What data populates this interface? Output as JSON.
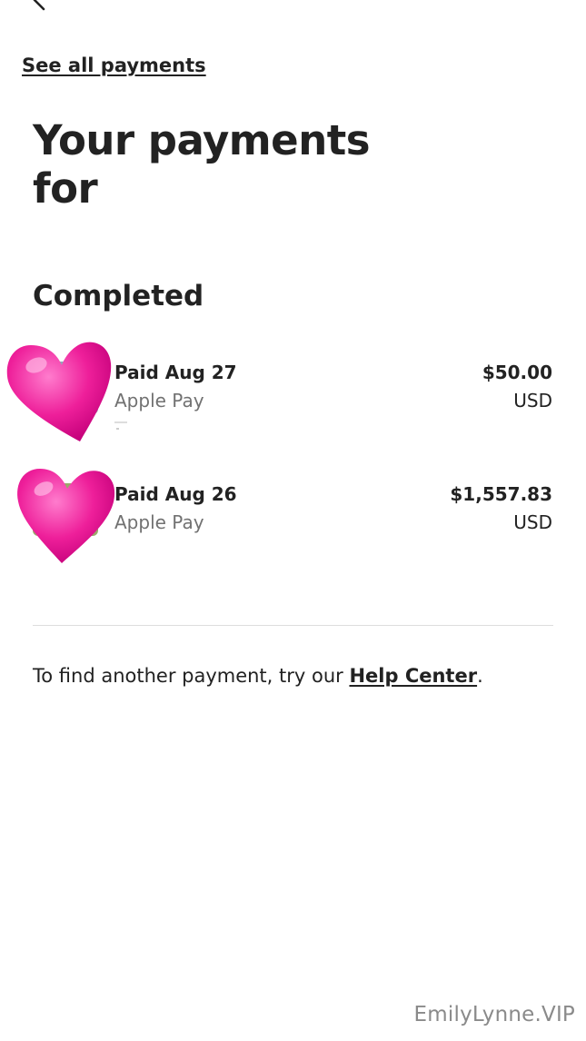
{
  "nav": {
    "back_icon": "chevron-left-icon",
    "see_all_label": "See all payments"
  },
  "page": {
    "title": "Your payments for"
  },
  "completed": {
    "heading": "Completed",
    "payments": [
      {
        "status": "Paid Aug 27",
        "method": "Apple Pay",
        "amount": "$50.00",
        "currency": "USD"
      },
      {
        "status": "Paid Aug 26",
        "method": "Apple Pay",
        "amount": "$1,557.83",
        "currency": "USD"
      }
    ]
  },
  "footer": {
    "help_prefix": "To find another payment, try our ",
    "help_link": "Help Center",
    "help_suffix": "."
  },
  "watermark": {
    "text": "EmilyLynne.VIP"
  },
  "colors": {
    "text_primary": "#222222",
    "text_secondary": "#717171",
    "divider": "#dddddd",
    "heart_sticker": "#ee1f9a",
    "watermark": "#8a8a8a"
  }
}
